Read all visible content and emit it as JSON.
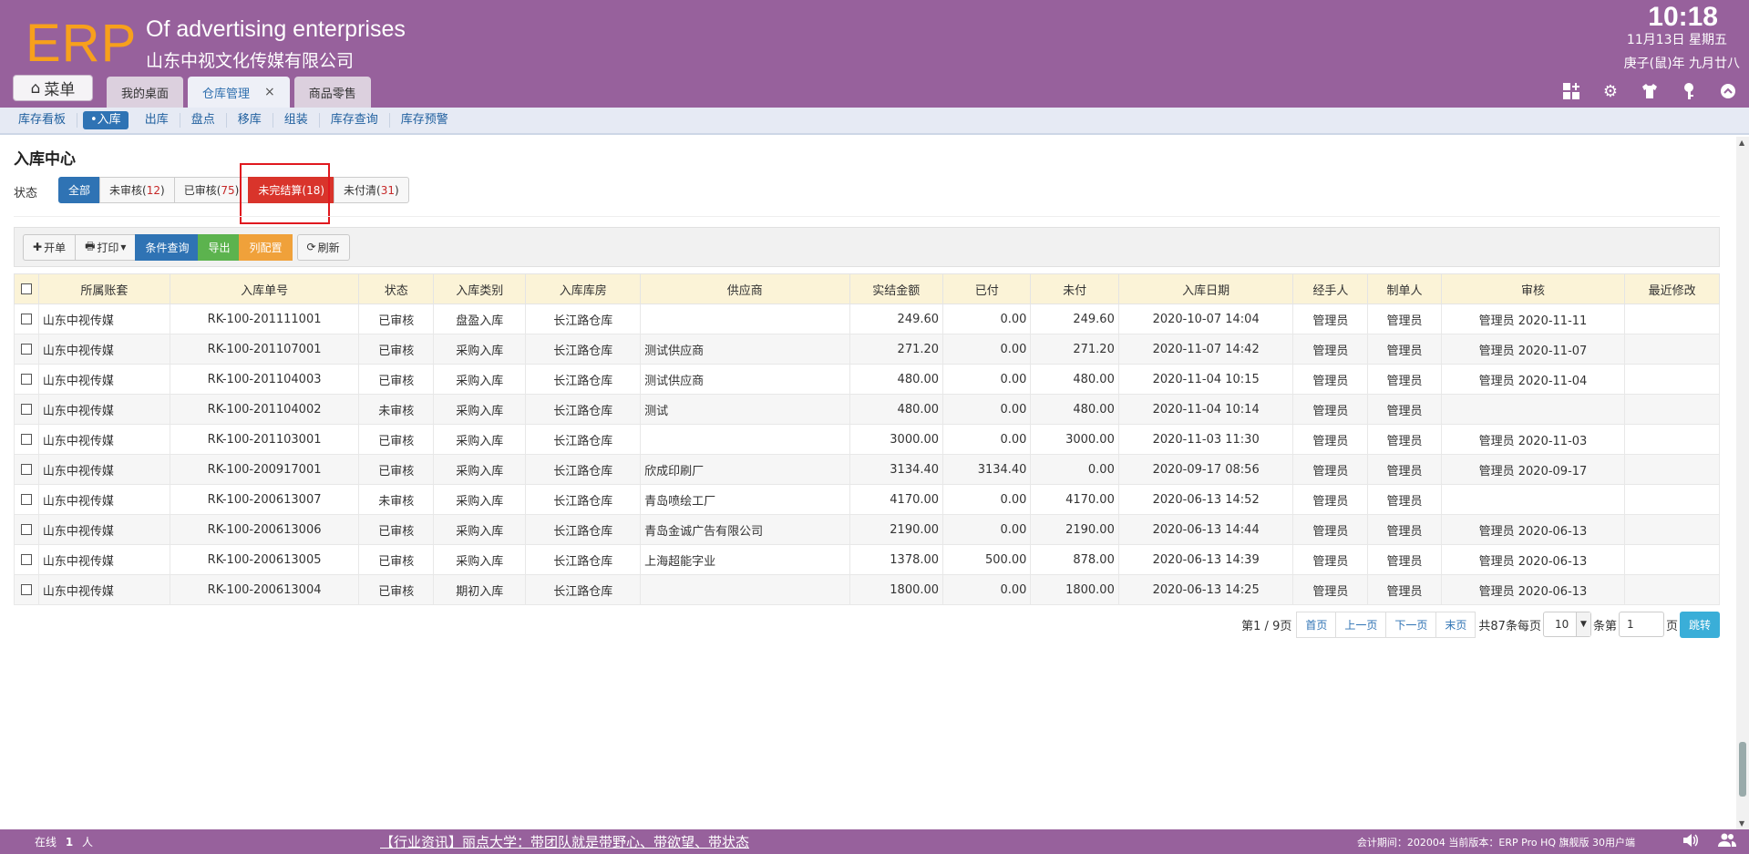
{
  "header": {
    "logo": "ERP",
    "company_en": "Of advertising enterprises",
    "company_cn": "山东中视文化传媒有限公司",
    "time": "10:18",
    "date": "11月13日 星期五",
    "lunar": "庚子(鼠)年 九月廿八",
    "menu_label": "菜单",
    "tabs": [
      {
        "label": "我的桌面"
      },
      {
        "label": "仓库管理",
        "close": "×"
      },
      {
        "label": "商品零售"
      }
    ],
    "icons": [
      "grid-icon",
      "gear-icon",
      "shirt-icon",
      "key-icon",
      "chevron-up-icon"
    ]
  },
  "subnav": {
    "items": [
      "库存看板",
      "•入库",
      "出库",
      "盘点",
      "移库",
      "组装",
      "库存查询",
      "库存预警"
    ]
  },
  "main": {
    "title": "入库中心",
    "status_label": "状态",
    "status_tabs": [
      {
        "label": "全部",
        "count": ""
      },
      {
        "label": "未审核",
        "count": "12"
      },
      {
        "label": "已审核",
        "count": "75"
      },
      {
        "label": "未完结算",
        "count": "18"
      },
      {
        "label": "未付清",
        "count": "31"
      }
    ],
    "toolbar": {
      "new": "开单",
      "print": "打印",
      "query": "条件查询",
      "export": "导出",
      "columns": "列配置",
      "refresh": "刷新"
    },
    "columns": [
      "所属账套",
      "入库单号",
      "状态",
      "入库类别",
      "入库库房",
      "供应商",
      "实结金额",
      "已付",
      "未付",
      "入库日期",
      "经手人",
      "制单人",
      "审核",
      "最近修改"
    ],
    "rows": [
      {
        "account": "山东中视传媒",
        "no": "RK-100-201111001",
        "status": "已审核",
        "type": "盘盈入库",
        "warehouse": "长江路仓库",
        "supplier": "",
        "amount": "249.60",
        "paid": "0.00",
        "unpaid": "249.60",
        "date": "2020-10-07 14:04",
        "handler": "管理员",
        "creator": "管理员",
        "audit": "管理员 2020-11-11",
        "modified": ""
      },
      {
        "account": "山东中视传媒",
        "no": "RK-100-201107001",
        "status": "已审核",
        "type": "采购入库",
        "warehouse": "长江路仓库",
        "supplier": "测试供应商",
        "amount": "271.20",
        "paid": "0.00",
        "unpaid": "271.20",
        "date": "2020-11-07 14:42",
        "handler": "管理员",
        "creator": "管理员",
        "audit": "管理员 2020-11-07",
        "modified": ""
      },
      {
        "account": "山东中视传媒",
        "no": "RK-100-201104003",
        "status": "已审核",
        "type": "采购入库",
        "warehouse": "长江路仓库",
        "supplier": "测试供应商",
        "amount": "480.00",
        "paid": "0.00",
        "unpaid": "480.00",
        "date": "2020-11-04 10:15",
        "handler": "管理员",
        "creator": "管理员",
        "audit": "管理员 2020-11-04",
        "modified": ""
      },
      {
        "account": "山东中视传媒",
        "no": "RK-100-201104002",
        "status": "未审核",
        "type": "采购入库",
        "warehouse": "长江路仓库",
        "supplier": "测试",
        "amount": "480.00",
        "paid": "0.00",
        "unpaid": "480.00",
        "date": "2020-11-04 10:14",
        "handler": "管理员",
        "creator": "管理员",
        "audit": "",
        "modified": ""
      },
      {
        "account": "山东中视传媒",
        "no": "RK-100-201103001",
        "status": "已审核",
        "type": "采购入库",
        "warehouse": "长江路仓库",
        "supplier": "",
        "amount": "3000.00",
        "paid": "0.00",
        "unpaid": "3000.00",
        "date": "2020-11-03 11:30",
        "handler": "管理员",
        "creator": "管理员",
        "audit": "管理员 2020-11-03",
        "modified": ""
      },
      {
        "account": "山东中视传媒",
        "no": "RK-100-200917001",
        "status": "已审核",
        "type": "采购入库",
        "warehouse": "长江路仓库",
        "supplier": "欣成印刷厂",
        "amount": "3134.40",
        "paid": "3134.40",
        "unpaid": "0.00",
        "date": "2020-09-17 08:56",
        "handler": "管理员",
        "creator": "管理员",
        "audit": "管理员 2020-09-17",
        "modified": ""
      },
      {
        "account": "山东中视传媒",
        "no": "RK-100-200613007",
        "status": "未审核",
        "type": "采购入库",
        "warehouse": "长江路仓库",
        "supplier": "青岛喷绘工厂",
        "amount": "4170.00",
        "paid": "0.00",
        "unpaid": "4170.00",
        "date": "2020-06-13 14:52",
        "handler": "管理员",
        "creator": "管理员",
        "audit": "",
        "modified": ""
      },
      {
        "account": "山东中视传媒",
        "no": "RK-100-200613006",
        "status": "已审核",
        "type": "采购入库",
        "warehouse": "长江路仓库",
        "supplier": "青岛金诚广告有限公司",
        "amount": "2190.00",
        "paid": "0.00",
        "unpaid": "2190.00",
        "date": "2020-06-13 14:44",
        "handler": "管理员",
        "creator": "管理员",
        "audit": "管理员 2020-06-13",
        "modified": ""
      },
      {
        "account": "山东中视传媒",
        "no": "RK-100-200613005",
        "status": "已审核",
        "type": "采购入库",
        "warehouse": "长江路仓库",
        "supplier": "上海超能字业",
        "amount": "1378.00",
        "paid": "500.00",
        "unpaid": "878.00",
        "date": "2020-06-13 14:39",
        "handler": "管理员",
        "creator": "管理员",
        "audit": "管理员 2020-06-13",
        "modified": ""
      },
      {
        "account": "山东中视传媒",
        "no": "RK-100-200613004",
        "status": "已审核",
        "type": "期初入库",
        "warehouse": "长江路仓库",
        "supplier": "",
        "amount": "1800.00",
        "paid": "0.00",
        "unpaid": "1800.00",
        "date": "2020-06-13 14:25",
        "handler": "管理员",
        "creator": "管理员",
        "audit": "管理员 2020-06-13",
        "modified": ""
      }
    ],
    "pager": {
      "page_info": "第1 / 9页",
      "first": "首页",
      "prev": "上一页",
      "next": "下一页",
      "last": "末页",
      "total": "共87条每页",
      "page_size": "10",
      "unit": "条第",
      "page_input": "1",
      "page_suffix": "页",
      "go": "跳转"
    }
  },
  "footer": {
    "online_prefix": "在线",
    "online_count": "1",
    "online_suffix": "人",
    "news": "【行业资讯】丽点大学：带团队就是带野心、带欲望、带状态",
    "period": "会计期间：202004 当前版本：ERP Pro HQ 旗舰版 30用户端"
  },
  "colors": {
    "header_bg": "#97619c",
    "logo": "#f7a01c",
    "primary": "#2f73b4",
    "danger": "#d9342b",
    "success": "#5cb34e",
    "warning": "#f0a13a"
  }
}
